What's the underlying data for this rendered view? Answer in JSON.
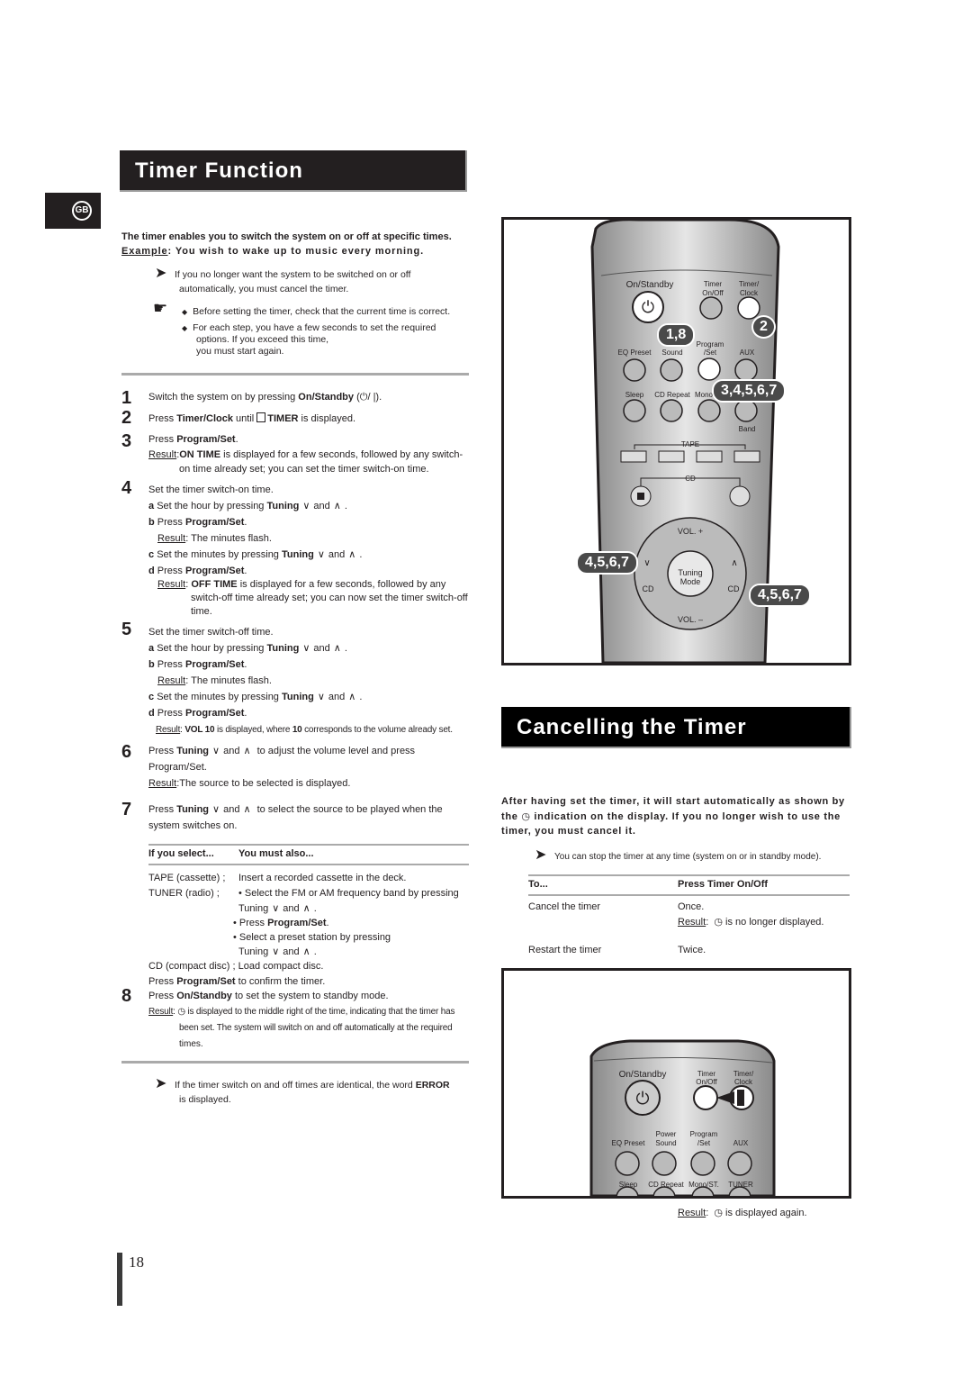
{
  "page": {
    "language_badge": "GB",
    "page_number": "18"
  },
  "timer_function": {
    "title": "Timer Function",
    "intro_line1": "The timer enables you to switch the system on or off at specific times.",
    "intro_example_label": "Example",
    "intro_example_text": ": You wish to wake up to music every morning.",
    "note_cancel_1": "If you no longer want the system to be switched on or off",
    "note_cancel_2": "automatically, you must cancel the timer.",
    "tip_1": "Before setting the timer, check that the current time is correct.",
    "tip_2a": "For each step, you have a few seconds to set the required",
    "tip_2b": "options. If you exceed this time,",
    "tip_2c": "you must start again.",
    "steps": {
      "s1": {
        "num": "1",
        "pre": "Switch the system on by pressing ",
        "bold": "On/Standby",
        "post": " (⏻/ |)."
      },
      "s2": {
        "num": "2",
        "pre": "Press ",
        "bold": "Timer/Clock",
        "mid": " until ",
        "bold2": "TIMER",
        "post": " is displayed."
      },
      "s3": {
        "num": "3",
        "pre": "Press ",
        "bold": "Program/Set",
        "post": ".",
        "result_label": "Result",
        "result_bold": "ON TIME",
        "result_text": " is displayed  for a few seconds, followed by any switch-",
        "result_text2": "on time already set; you can set the timer switch-on time."
      },
      "s4": {
        "num": "4",
        "text": "Set the timer switch-on time.",
        "a": "Set the hour by pressing ",
        "b": "Press ",
        "c": "Set the minutes by pressing ",
        "d": "Press ",
        "b_result": ": The minutes flash.",
        "d_result_bold": "OFF TIME",
        "d_result_text": " is displayed  for a few seconds, followed by any",
        "d_result_text2": "switch-off time already set; you can now set the timer switch-off",
        "d_result_text3": "time."
      },
      "s5": {
        "num": "5",
        "text": "Set the timer switch-off time.",
        "b_result": ": The minutes flash.",
        "d_result_bold": "VOL 10",
        "d_result_text": " is displayed, where ",
        "d_result_bold2": "10",
        "d_result_text2": " corresponds to the volume already set."
      },
      "s6": {
        "num": "6",
        "pre": "Press ",
        "post": " to adjust the volume level and press",
        "line2": "Program/Set.",
        "result_text": ":The source to be selected is displayed."
      },
      "s7": {
        "num": "7",
        "pre": "Press ",
        "post": " to select the source to be played when the",
        "line2": "system switches on."
      },
      "s8": {
        "num": "8",
        "pre": "Press ",
        "bold": "On/Standby",
        "post": " to set the system to standby mode.",
        "result_text": " is displayed to the middle right of the time, indicating that the timer has",
        "result_text2": "been set. The system will switch on and off automatically at the required",
        "result_text3": "times."
      }
    },
    "labels": {
      "result": "Result",
      "tuning": "Tuning",
      "and": "and",
      "program_set": "Program/Set",
      "a": "a",
      "b": "b",
      "c": "c",
      "d": "d"
    },
    "source_table": {
      "headers": [
        "If you select...",
        "You must also..."
      ],
      "rows": [
        {
          "source": "TAPE (cassette) ;",
          "action": "Insert a recorded cassette in the deck."
        },
        {
          "source": "TUNER (radio) ;",
          "action": "• Select the FM or AM frequency band by pressing"
        }
      ],
      "tuner_tuning": "Tuning",
      "tuner_press": "• Press ",
      "tuner_select": "• Select a preset station by pressing",
      "cd_row": "CD (compact disc) ; Load compact disc.",
      "confirm_pre": "Press ",
      "confirm_post": " to confirm the timer."
    },
    "error_note_pre": "If the timer switch on and off times are identical, the word ",
    "error_note_bold": "ERROR",
    "error_note_2": "is displayed."
  },
  "remote1": {
    "labels": {
      "on_standby": "On/Standby",
      "timer_onoff": "Timer\nOn/Off",
      "timer_clock": "Timer/\nClock",
      "eq_preset": "EQ  Preset",
      "sound": "Sound",
      "program_set": "Program\n/Set",
      "aux": "AUX",
      "sleep": "Sleep",
      "cd_repeat": "CD Repeat",
      "mono": "Mono",
      "band": "Band",
      "tape": "TAPE",
      "cd": "CD",
      "vol_plus": "VOL. +",
      "vol_minus": "VOL. –",
      "tuning_mode": "Tuning\nMode",
      "cd_left": "CD",
      "cd_right": "CD"
    },
    "callouts": {
      "power": "1,8",
      "timer_clock": "2",
      "program": "3,4,5,6,7",
      "down": "4,5,6,7",
      "up": "4,5,6,7"
    }
  },
  "cancelling": {
    "title": "Cancelling the Timer",
    "intro1": "After having set the timer, it will start automatically as shown by",
    "intro2a": "the ",
    "intro2b": " indication on the display. If you no longer wish to use the",
    "intro3": "timer, you must cancel it.",
    "note": "You can stop the timer at any time (system on or in standby mode).",
    "table": {
      "headers": [
        "To...",
        "Press Timer On/Off"
      ],
      "rows": [
        {
          "to": "Cancel the timer",
          "press": "Once.",
          "result": " is no longer displayed."
        },
        {
          "to": "Restart the timer",
          "press": "Twice."
        }
      ]
    },
    "final_result": " is displayed again."
  },
  "remote2": {
    "labels": {
      "on_standby": "On/Standby",
      "timer_onoff": "Timer\nOn/Off",
      "timer_clock": "Timer/\nClock",
      "eq_preset": "EQ  Preset",
      "power_sound": "Power\nSound",
      "program_set": "Program\n/Set",
      "aux": "AUX",
      "sleep": "Sleep",
      "cd_repeat": "CD Repeat",
      "mono_st": "Mono/ST.",
      "tuner": "TUNER"
    }
  }
}
